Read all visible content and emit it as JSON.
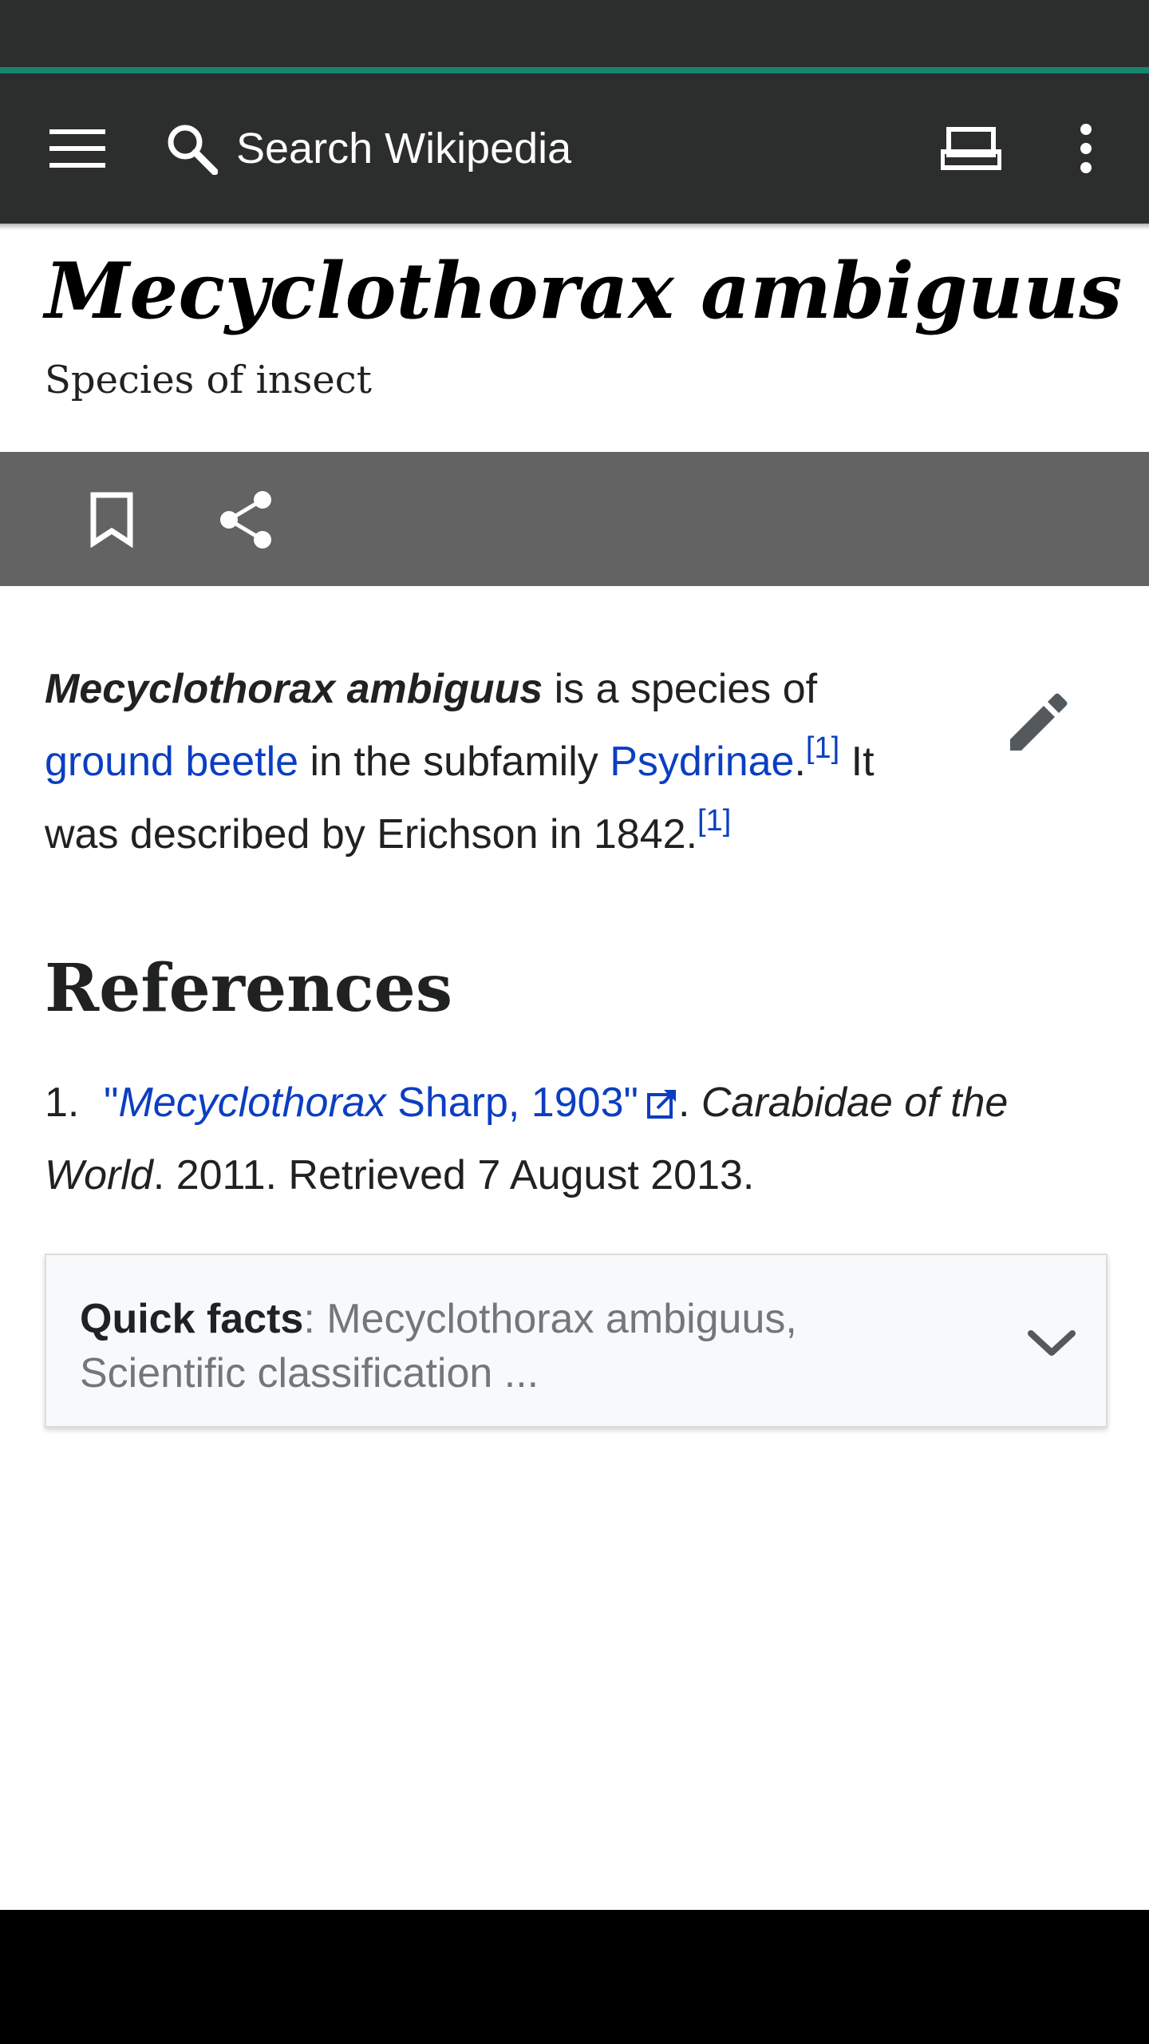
{
  "toolbar": {
    "search_placeholder": "Search Wikipedia",
    "menu_icon": "hamburger-menu-icon",
    "search_icon": "search-icon",
    "tabs_icon": "tabs-icon",
    "overflow_icon": "more-vert-icon"
  },
  "article": {
    "title": "Mecyclothorax ambiguus",
    "description": "Species of insect"
  },
  "actions": {
    "bookmark_icon": "bookmark-icon",
    "share_icon": "share-icon"
  },
  "lead": {
    "bold_term": "Mecyclothorax ambiguus",
    "text_1": " is a species of ",
    "link_ground_beetle": "ground beetle",
    "text_2": " in the subfamily ",
    "link_psydrinae": "Psydrinae",
    "text_3": ".",
    "cite_1": "[1]",
    "text_4": " It was described by Erichson in 1842.",
    "cite_2": "[1]",
    "edit_icon": "edit-pencil-icon"
  },
  "references": {
    "heading": "References",
    "items": [
      {
        "number": "1.",
        "link_quote_open": "\"",
        "link_italic": "Mecyclothorax",
        "link_rest": " Sharp, 1903\"",
        "text_after_link": ". ",
        "work_italic": "Carabidae of the World",
        "text_end": ". 2011. Retrieved 7 August 2013."
      }
    ]
  },
  "quick_facts": {
    "label": "Quick facts",
    "summary": ": Mecyclothorax ambiguus, Scientific classification ...",
    "chevron_icon": "chevron-down-icon"
  },
  "colors": {
    "toolbar_bg": "#2c2d2d",
    "accent": "#14866d",
    "action_bar_bg": "#636363",
    "link": "#0b3ec2"
  }
}
